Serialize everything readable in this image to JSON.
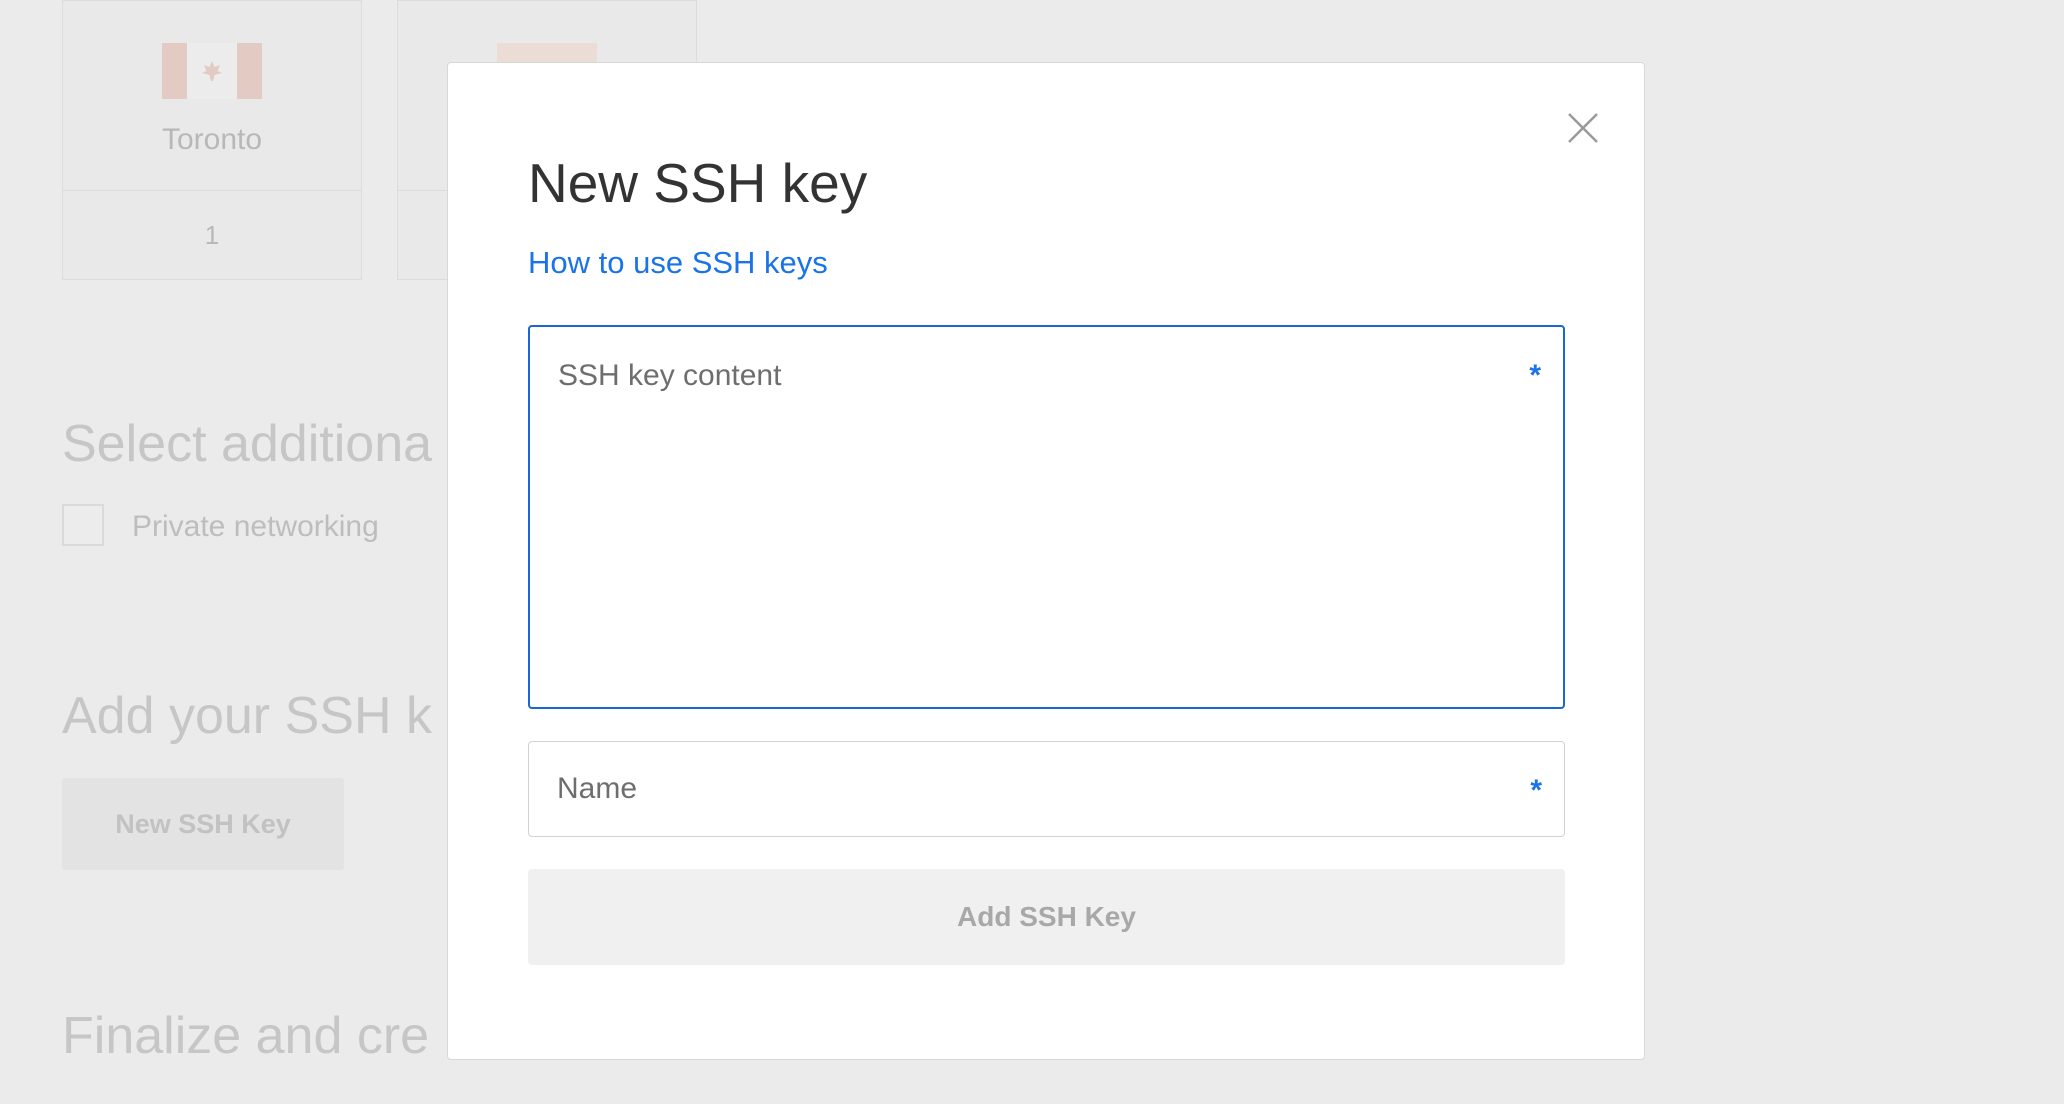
{
  "background": {
    "region_cards": [
      {
        "city": "Toronto",
        "count": "1",
        "flag_icon": "canada-flag-icon"
      },
      {
        "city": "",
        "count": "",
        "flag_icon": "flag-icon"
      }
    ],
    "sections": {
      "additional_options_heading": "Select additiona",
      "private_networking_label": "Private networking",
      "ssh_heading": "Add your SSH k",
      "new_ssh_key_button": "New SSH Key",
      "finalize_heading": "Finalize and cre"
    }
  },
  "modal": {
    "title": "New SSH key",
    "help_link": "How to use SSH keys",
    "close_icon": "close-icon",
    "ssh_key_field": {
      "label": "SSH key content",
      "required_marker": "*",
      "value": ""
    },
    "name_field": {
      "label": "Name",
      "required_marker": "*",
      "value": ""
    },
    "submit_label": "Add SSH Key",
    "colors": {
      "accent": "#1a73e8",
      "focus_border": "#1a66d6",
      "button_disabled_bg": "#f0f0f0"
    }
  }
}
